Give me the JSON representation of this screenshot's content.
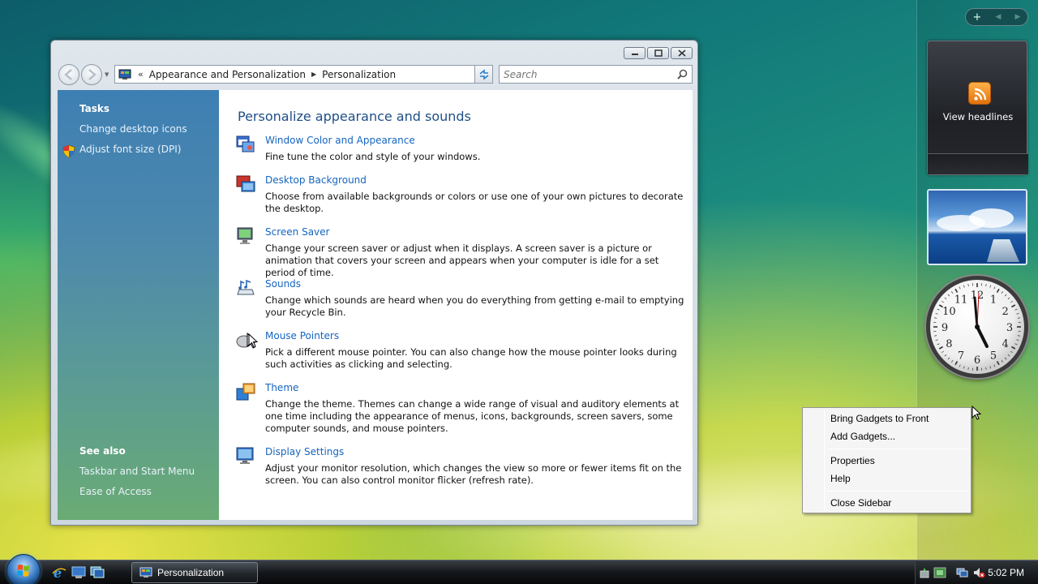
{
  "window": {
    "breadcrumb": [
      "Appearance and Personalization",
      "Personalization"
    ],
    "search_placeholder": "Search"
  },
  "left_pane": {
    "tasks_header": "Tasks",
    "tasks": [
      "Change desktop icons",
      "Adjust font size (DPI)"
    ],
    "see_also_header": "See also",
    "see_also": [
      "Taskbar and Start Menu",
      "Ease of Access"
    ]
  },
  "content": {
    "heading": "Personalize appearance and sounds",
    "items": [
      {
        "title": "Window Color and Appearance",
        "desc": "Fine tune the color and style of your windows."
      },
      {
        "title": "Desktop Background",
        "desc": "Choose from available backgrounds or colors or use one of your own pictures to decorate the desktop."
      },
      {
        "title": "Screen Saver",
        "desc": "Change your screen saver or adjust when it displays. A screen saver is a picture or animation that covers your screen and appears when your computer is idle for a set period of time."
      },
      {
        "title": "Sounds",
        "desc": "Change which sounds are heard when you do everything from getting e-mail to emptying your Recycle Bin."
      },
      {
        "title": "Mouse Pointers",
        "desc": "Pick a different mouse pointer. You can also change how the mouse pointer looks during such activities as clicking and selecting."
      },
      {
        "title": "Theme",
        "desc": "Change the theme. Themes can change a wide range of visual and auditory elements at one time including the appearance of menus, icons, backgrounds, screen savers, some computer sounds, and mouse pointers."
      },
      {
        "title": "Display Settings",
        "desc": "Adjust your monitor resolution, which changes the view so more or fewer items fit on the screen. You can also control monitor flicker (refresh rate)."
      }
    ]
  },
  "sidebar": {
    "feed_label": "View headlines",
    "clock_numbers": [
      "12",
      "1",
      "2",
      "3",
      "4",
      "5",
      "6",
      "7",
      "8",
      "9",
      "10",
      "11"
    ]
  },
  "context_menu": {
    "items": [
      "Bring Gadgets to Front",
      "Add Gadgets...",
      "Properties",
      "Help",
      "Close Sidebar"
    ]
  },
  "taskbar": {
    "task_label": "Personalization",
    "clock": "5:02 PM"
  },
  "colors": {
    "link": "#1565c0",
    "heading": "#1f4e86",
    "nav_pane_top": "#3e7fb3",
    "nav_pane_bottom": "#6aab74"
  }
}
